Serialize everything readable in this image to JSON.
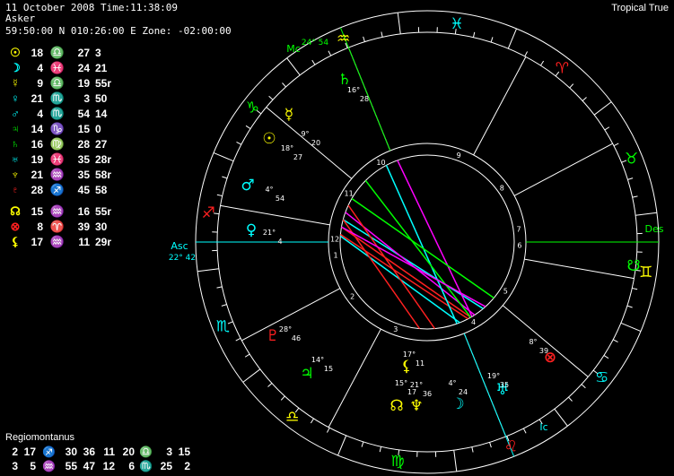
{
  "header": {
    "line1": "11 October 2008 Time:11:38:09",
    "line2": "Asker",
    "line3": "59:50:00 N 010:26:00 E Zone: -02:00:00",
    "mode": "Tropical True"
  },
  "planets": [
    {
      "glyph": "☉",
      "color": "#ffff00",
      "deg": "18",
      "sign": "♎",
      "sign_color": "#ffff00",
      "min": "27",
      "sec": "3"
    },
    {
      "glyph": "☽",
      "color": "#00ffff",
      "deg": "4",
      "sign": "♓",
      "sign_color": "#00ffff",
      "min": "24",
      "sec": "21"
    },
    {
      "glyph": "☿",
      "color": "#ffff00",
      "deg": "9",
      "sign": "♎",
      "sign_color": "#ffff00",
      "min": "19",
      "sec": "55r"
    },
    {
      "glyph": "♀",
      "color": "#00ffff",
      "deg": "21",
      "sign": "♏",
      "sign_color": "#ffffff",
      "min": "3",
      "sec": "50"
    },
    {
      "glyph": "♂",
      "color": "#00ffff",
      "deg": "4",
      "sign": "♏",
      "sign_color": "#ffffff",
      "min": "54",
      "sec": "14"
    },
    {
      "glyph": "♃",
      "color": "#00ff00",
      "deg": "14",
      "sign": "♑",
      "sign_color": "#00ff00",
      "min": "15",
      "sec": "0"
    },
    {
      "glyph": "♄",
      "color": "#00ff00",
      "deg": "16",
      "sign": "♍",
      "sign_color": "#00ff00",
      "min": "28",
      "sec": "27"
    },
    {
      "glyph": "♅",
      "color": "#00ffff",
      "deg": "19",
      "sign": "♓",
      "sign_color": "#00ffff",
      "min": "35",
      "sec": "28r"
    },
    {
      "glyph": "♆",
      "color": "#ffff00",
      "deg": "21",
      "sign": "♒",
      "sign_color": "#ffff00",
      "min": "35",
      "sec": "58r"
    },
    {
      "glyph": "♇",
      "color": "#ff2020",
      "deg": "28",
      "sign": "♐",
      "sign_color": "#ff2020",
      "min": "45",
      "sec": "58"
    }
  ],
  "points": [
    {
      "glyph": "☊",
      "color": "#ffff00",
      "deg": "15",
      "sign": "♒",
      "sign_color": "#ffff00",
      "min": "16",
      "sec": "55r"
    },
    {
      "glyph": "⊗",
      "color": "#ff2020",
      "deg": "8",
      "sign": "♈",
      "sign_color": "#ff2020",
      "min": "39",
      "sec": "30"
    },
    {
      "glyph": "⚸",
      "color": "#ffff00",
      "deg": "17",
      "sign": "♒",
      "sign_color": "#ffff00",
      "min": "11",
      "sec": "29r"
    }
  ],
  "house_system": "Regiomontanus",
  "houses_row1": [
    "2",
    "17",
    "♐",
    "30",
    "36",
    "11",
    "20",
    "♎",
    "3",
    "15"
  ],
  "houses_row2": [
    "3",
    "5",
    "♒",
    "55",
    "47",
    "12",
    "6",
    "♏",
    "25",
    "2"
  ],
  "chart_labels": {
    "asc": "Asc",
    "asc_deg": "22° 42",
    "mc": "Mc",
    "mc_deg": "24° 54",
    "des": "Des",
    "ic": "Ic"
  },
  "house_numbers": [
    "1",
    "2",
    "3",
    "4",
    "5",
    "6",
    "7",
    "8",
    "9",
    "10",
    "11",
    "12"
  ],
  "wheel_planets": [
    {
      "glyph": "☉",
      "color": "#ffff00",
      "deg": "18°",
      "min": "27"
    },
    {
      "glyph": "☿",
      "color": "#ffff00",
      "deg": "9°",
      "min": "20"
    },
    {
      "glyph": "♂",
      "color": "#00ffff",
      "deg": "4°",
      "min": "54"
    },
    {
      "glyph": "♀",
      "color": "#00ffff",
      "deg": "21°",
      "min": "4"
    },
    {
      "glyph": "♄",
      "color": "#00ff00",
      "deg": "16°",
      "min": "28"
    },
    {
      "glyph": "♇",
      "color": "#ff2020",
      "deg": "28°",
      "min": "46"
    },
    {
      "glyph": "♃",
      "color": "#00ff00",
      "deg": "14°",
      "min": "15"
    },
    {
      "glyph": "⚸",
      "color": "#ffff00",
      "deg": "17°",
      "min": "11"
    },
    {
      "glyph": "☊",
      "color": "#ffff00",
      "deg": "15°",
      "min": "17"
    },
    {
      "glyph": "♆",
      "color": "#ffff00",
      "deg": "21°",
      "min": "36"
    },
    {
      "glyph": "☽",
      "color": "#00ffff",
      "deg": "4°",
      "min": "24"
    },
    {
      "glyph": "♅",
      "color": "#00ffff",
      "deg": "19°",
      "min": "35"
    },
    {
      "glyph": "⊗",
      "color": "#ff2020",
      "deg": "8°",
      "min": "39"
    }
  ],
  "wheel_signs": [
    {
      "glyph": "♌",
      "color": "#ff2020"
    },
    {
      "glyph": "♋",
      "color": "#00ffff"
    },
    {
      "glyph": "♊",
      "color": "#ffff00"
    },
    {
      "glyph": "♉",
      "color": "#00ff00"
    },
    {
      "glyph": "♈",
      "color": "#ff2020"
    },
    {
      "glyph": "♓",
      "color": "#00ffff"
    },
    {
      "glyph": "♒",
      "color": "#ffff00"
    },
    {
      "glyph": "♑",
      "color": "#00ff00"
    },
    {
      "glyph": "♐",
      "color": "#ff2020"
    },
    {
      "glyph": "♏",
      "color": "#00ffff"
    },
    {
      "glyph": "♎",
      "color": "#ffff00"
    },
    {
      "glyph": "♍",
      "color": "#00ff00"
    }
  ],
  "node_south": {
    "glyph": "☋",
    "color": "#00ff00"
  }
}
